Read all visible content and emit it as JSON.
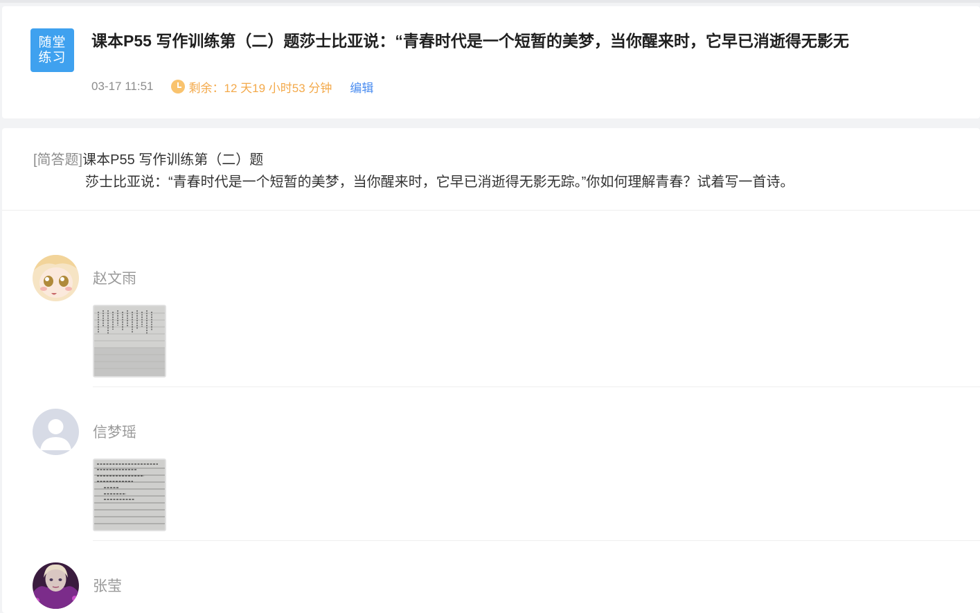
{
  "header": {
    "badge_line1": "随堂",
    "badge_line2": "练习",
    "title": "课本P55 写作训练第（二）题莎士比亚说：“青春时代是一个短暂的美梦，当你醒来时，它早已消逝得无影无",
    "date": "03-17 11:51",
    "remaining": "剩余：12  天19  小时53  分钟",
    "edit_label": "编辑"
  },
  "question": {
    "type_label": "[简答题]",
    "title": "课本P55 写作训练第（二）题",
    "body": "莎士比亚说：“青春时代是一个短暂的美梦，当你醒来时，它早已消逝得无影无踪。”你如何理解青春？试着写一首诗。"
  },
  "answers": [
    {
      "name": "赵文雨",
      "avatar": "anime-girl-avatar",
      "thumb": "handwritten-vertical-poem-photo"
    },
    {
      "name": "信梦瑶",
      "avatar": "default-user-avatar",
      "thumb": "handwritten-lined-paper-photo"
    },
    {
      "name": "张莹",
      "avatar": "purple-doll-avatar"
    }
  ],
  "colors": {
    "badge": "#3fa1ef",
    "remaining": "#f3a94a",
    "link": "#4a8cf0",
    "page_bg": "#f2f3f5"
  }
}
